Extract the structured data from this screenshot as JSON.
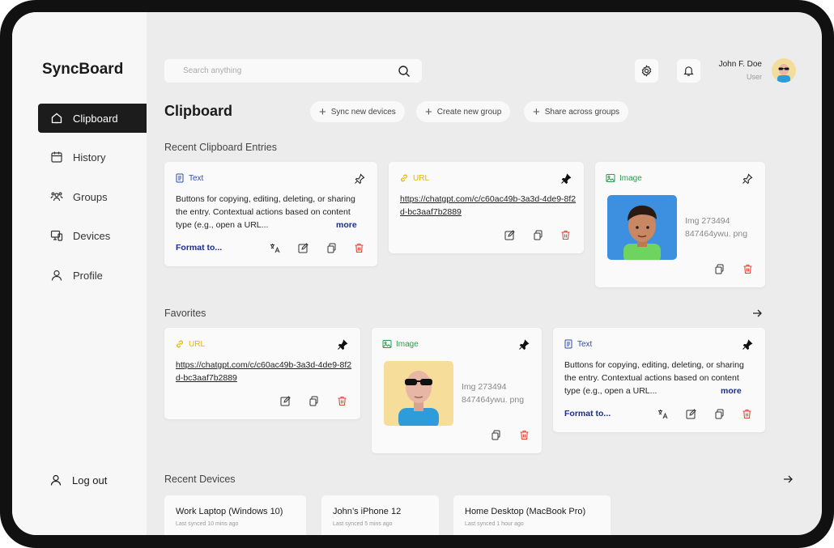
{
  "app": {
    "name": "SyncBoard"
  },
  "sidebar": {
    "items": [
      {
        "label": "Clipboard",
        "icon": "home-icon"
      },
      {
        "label": "History",
        "icon": "calendar-icon"
      },
      {
        "label": "Groups",
        "icon": "groups-icon"
      },
      {
        "label": "Devices",
        "icon": "devices-icon"
      },
      {
        "label": "Profile",
        "icon": "user-icon"
      }
    ],
    "logout_label": "Log out"
  },
  "search": {
    "placeholder": "Search anything",
    "value": ""
  },
  "user": {
    "name": "John F. Doe",
    "role": "User"
  },
  "page": {
    "title": "Clipboard",
    "actions": [
      "Sync new devices",
      "Create new group",
      "Share across groups"
    ]
  },
  "recent": {
    "title": "Recent Clipboard Entries",
    "cards": [
      {
        "type": "Text",
        "text": "Buttons for copying, editing, deleting, or sharing the entry. Contextual actions based on content type (e.g., open a URL...",
        "more": "more",
        "format": "Format to...",
        "pinned": false
      },
      {
        "type": "URL",
        "url": "https://chatgpt.com/c/c60ac49b-3a3d-4de9-8f2d-bc3aaf7b2889",
        "pinned": true
      },
      {
        "type": "Image",
        "meta_line1": "Img 273494",
        "meta_line2": "847464ywu. png",
        "pinned": false
      }
    ]
  },
  "favorites": {
    "title": "Favorites",
    "cards": [
      {
        "type": "URL",
        "url": "https://chatgpt.com/c/c60ac49b-3a3d-4de9-8f2d-bc3aaf7b2889",
        "pinned": true
      },
      {
        "type": "Image",
        "meta_line1": "Img 273494",
        "meta_line2": "847464ywu. png",
        "pinned": true
      },
      {
        "type": "Text",
        "text": "Buttons for copying, editing, deleting, or sharing the entry. Contextual actions based on content type (e.g., open a URL...",
        "more": "more",
        "format": "Format to...",
        "pinned": true
      }
    ]
  },
  "devices": {
    "title": "Recent Devices",
    "items": [
      {
        "name": "Work Laptop (Windows 10)",
        "synced": "Last synced 10 mins ago"
      },
      {
        "name": "John’s iPhone 12",
        "synced": "Last synced 5 mins ago"
      },
      {
        "name": "Home Desktop (MacBook Pro)",
        "synced": "Last synced 1 hour ago"
      }
    ]
  },
  "colors": {
    "text_type": "#2f4ca8",
    "url_type": "#e0b800",
    "image_type": "#2f9a4f",
    "delete": "#e04a3a",
    "link": "#1a2e8a",
    "active_nav": "#1c1c1c"
  }
}
